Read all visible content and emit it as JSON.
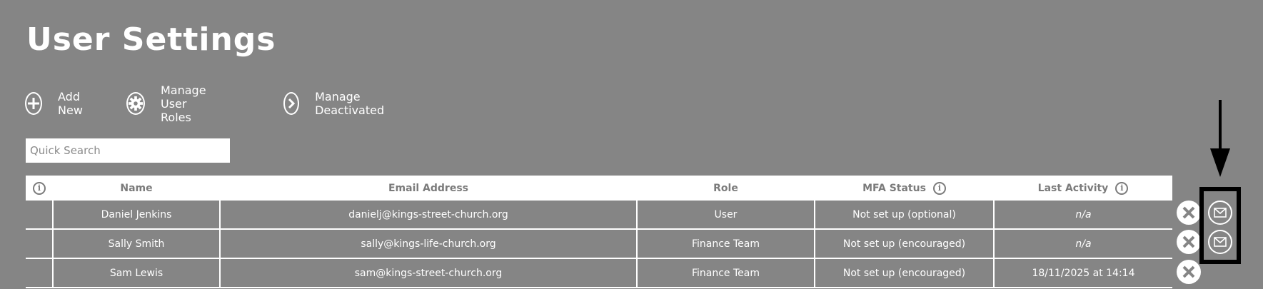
{
  "page": {
    "title": "User Settings"
  },
  "toolbar": {
    "add_new": "Add New",
    "manage_roles": "Manage User Roles",
    "manage_deactivated": "Manage Deactivated"
  },
  "search": {
    "placeholder": "Quick Search",
    "value": ""
  },
  "table": {
    "columns": [
      "",
      "Name",
      "Email Address",
      "Role",
      "MFA Status",
      "Last Activity"
    ],
    "rows": [
      {
        "name": "Daniel Jenkins",
        "email": "danielj@kings-street-church.org",
        "role": "User",
        "mfa": "Not set up (optional)",
        "last_activity": "n/a",
        "has_mail": true
      },
      {
        "name": "Sally Smith",
        "email": "sally@kings-life-church.org",
        "role": "Finance Team",
        "mfa": "Not set up (encouraged)",
        "last_activity": "n/a",
        "has_mail": true
      },
      {
        "name": "Sam Lewis",
        "email": "sam@kings-street-church.org",
        "role": "Finance Team",
        "mfa": "Not set up (encouraged)",
        "last_activity": "18/11/2025 at 14:14",
        "has_mail": false
      }
    ]
  },
  "icons": {
    "add": "plus-circle-icon",
    "roles": "gear-icon",
    "deactivated": "chevron-right-circle-icon",
    "info": "info-icon",
    "delete": "close-circle-icon",
    "mail": "envelope-icon",
    "annotation": "arrow-down-icon"
  },
  "colors": {
    "background": "#858585",
    "header_text": "#7b7b7b",
    "highlight": "#000000"
  }
}
